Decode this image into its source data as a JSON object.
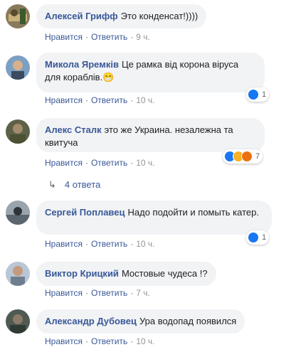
{
  "comments": [
    {
      "author": "Алексей Грифф",
      "text": "Это конденсат!))))",
      "like_label": "Нравится",
      "reply_label": "Ответить",
      "time": "9 ч."
    },
    {
      "author": "Микола Яремків",
      "text": "Це рамка від корона віруса для кораблів.😁",
      "like_label": "Нравится",
      "reply_label": "Ответить",
      "time": "10 ч.",
      "reaction_count": "1"
    },
    {
      "author": "Алекс Сталк",
      "text": "это же Украина. незалежна та квитуча",
      "like_label": "Нравится",
      "reply_label": "Ответить",
      "time": "10 ч.",
      "reaction_count": "7"
    },
    {
      "author": "Сергей Поплавец",
      "text": "Надо подойти и помыть катер.",
      "like_label": "Нравится",
      "reply_label": "Ответить",
      "time": "10 ч.",
      "reaction_count": "1"
    },
    {
      "author": "Виктор Крицкий",
      "text": "Мостовые чудеса !?",
      "like_label": "Нравится",
      "reply_label": "Ответить",
      "time": "7 ч."
    },
    {
      "author": "Александр Дубовец",
      "text": "Ура водопад появился",
      "like_label": "Нравится",
      "reply_label": "Ответить",
      "time": "10 ч."
    }
  ],
  "replies_link": "4 ответа",
  "colors": {
    "link": "#385898",
    "bubble": "#f2f3f5",
    "like_blue": "#1877f2"
  }
}
